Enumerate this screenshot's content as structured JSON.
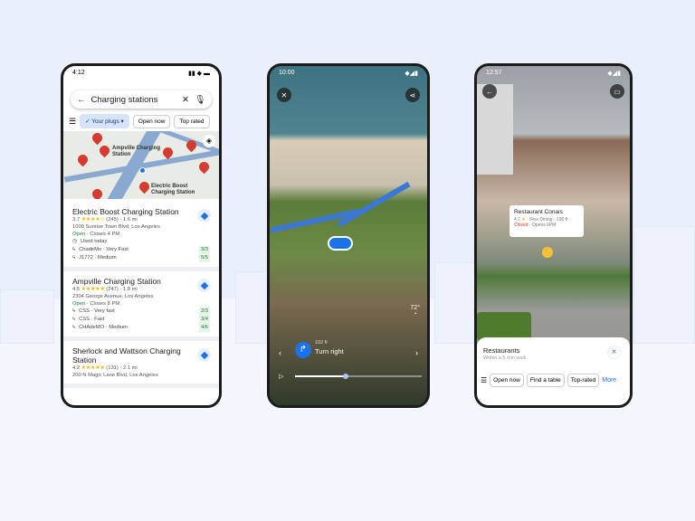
{
  "phone1": {
    "time": "4:12",
    "search_value": "Charging stations",
    "chips": [
      "Your plugs",
      "Open now",
      "Top rated"
    ],
    "map_labels": [
      "Ampville Charging Station",
      "Electric Boost Charging Station"
    ],
    "results": [
      {
        "name": "Electric Boost Charging Station",
        "rating": "3.7",
        "stars": "★★★★☆",
        "reviews": "(245) · 1.6 mi",
        "address": "1000 Sunrise Town Blvd, Los Angeles",
        "open": "Open",
        "hours": " · Closes 4 PM",
        "used": "Used today",
        "plugs": [
          {
            "type": "ChadeMo",
            "speed": " · Very Fast",
            "avail": "3/3"
          },
          {
            "type": "J1772",
            "speed": " · Medium",
            "avail": "5/5"
          }
        ]
      },
      {
        "name": "Ampville Charging Station",
        "rating": "4.5",
        "stars": "★★★★★",
        "reviews": "(247) · 1.8 mi",
        "address": "2304 George Avenue, Los Angeles",
        "open": "Open",
        "hours": " · Closes 8 PM",
        "plugs": [
          {
            "type": "CSS",
            "speed": " · Very fast",
            "avail": "2/3"
          },
          {
            "type": "CSS",
            "speed": " · Fast",
            "avail": "3/4"
          },
          {
            "type": "CHAdeMO",
            "speed": " · Medium",
            "avail": "4/6"
          }
        ]
      },
      {
        "name": "Sherlock and Wattson Charging Station",
        "rating": "4.2",
        "stars": "★★★★★",
        "reviews": "(131) · 2.1 mi",
        "address": "200 N Magic Lane Blvd, Los Angeles"
      }
    ]
  },
  "phone2": {
    "time": "10:00",
    "temperature": "72°",
    "distance": "102 ft",
    "instruction": "Turn right",
    "progress": 0.4
  },
  "phone3": {
    "time": "12:57",
    "place": {
      "name": "Restaurant Conais",
      "rating": "4.7",
      "category": " · Fine Dining · 190 ft",
      "status": "Closed",
      "hours": " · Opens 6PM"
    },
    "panel": {
      "title": "Restaurants",
      "subtitle": "Within a 5 min walk",
      "chips": [
        "Open now",
        "Find a table",
        "Top-rated"
      ],
      "more": "More"
    }
  }
}
